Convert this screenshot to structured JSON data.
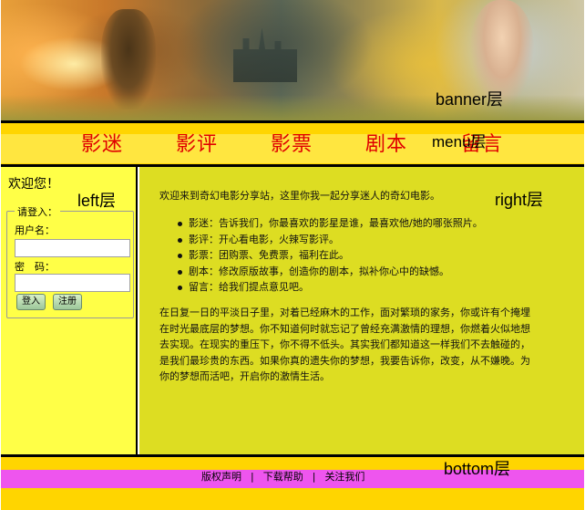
{
  "banner": {
    "label": "banner层"
  },
  "menu": {
    "label": "menu层",
    "items": [
      "影迷",
      "影评",
      "影票",
      "剧本",
      "留言"
    ],
    "text_color": "#e00000",
    "bg_color": "#ffd500"
  },
  "left": {
    "label": "left层",
    "welcome": "欢迎您！",
    "login": {
      "legend": "请登入：",
      "username_label": "用户名：",
      "username_value": "",
      "password_label": "密　码：",
      "password_value": "",
      "login_button": "登入",
      "register_button": "注册"
    },
    "bg_color": "#ffff47"
  },
  "right": {
    "label": "right层",
    "intro": "欢迎来到奇幻电影分享站，这里你我一起分享迷人的奇幻电影。",
    "features": [
      "影迷：告诉我们，你最喜欢的影星是谁，最喜欢他/她的哪张照片。",
      "影评：开心看电影，火辣写影评。",
      "影票：团购票、免费票，福利在此。",
      "剧本：修改原版故事，创造你的剧本，拟补你心中的缺憾。",
      "留言：给我们提点意见吧。"
    ],
    "paragraph": "在日复一日的平淡日子里，对着已经麻木的工作，面对繁琐的家务，你或许有个掩埋在时光最底层的梦想。你不知道何时就忘记了曾经充满激情的理想，你燃着火似地想去实现。在现实的重压下，你不得不低头。其实我们都知道这一样我们不去触碰的，是我们最珍贵的东西。如果你真的遗失你的梦想，我要告诉你，改变，从不嫌晚。为你的梦想而活吧，开启你的激情生活。",
    "bg_color": "#dddd22"
  },
  "bottom": {
    "label": "bottom层",
    "links": [
      "版权声明",
      "下载帮助",
      "关注我们"
    ],
    "separator": "|",
    "stripe_color": "#ee55ee"
  }
}
